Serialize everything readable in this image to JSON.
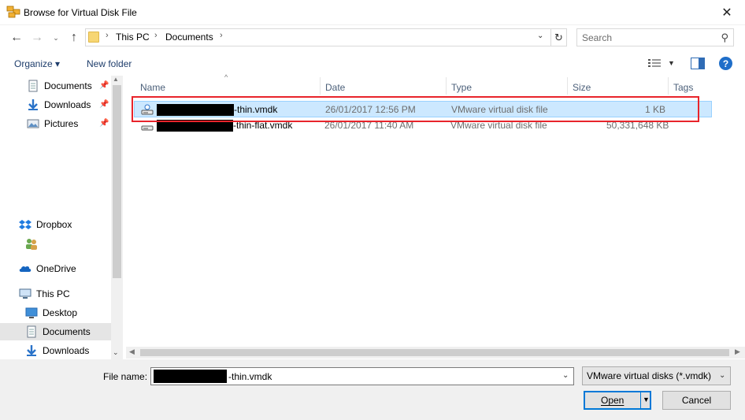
{
  "window": {
    "title": "Browse for Virtual Disk File",
    "close_glyph": "✕"
  },
  "address": {
    "crumbs": [
      "This PC",
      "Documents"
    ],
    "search_placeholder": "Search"
  },
  "toolbar": {
    "organize_label": "Organize ▾",
    "new_folder_label": "New folder",
    "help_label": "?"
  },
  "nav": {
    "items": [
      {
        "label": "Documents",
        "icon": "documents-icon",
        "pinned": true
      },
      {
        "label": "Downloads",
        "icon": "downloads-icon",
        "pinned": true
      },
      {
        "label": "Pictures",
        "icon": "pictures-icon",
        "pinned": true
      },
      {
        "label": "Dropbox",
        "icon": "dropbox-icon",
        "pinned": false
      },
      {
        "label": "",
        "icon": "shared-users-icon",
        "pinned": false
      },
      {
        "label": "OneDrive",
        "icon": "onedrive-icon",
        "pinned": false
      },
      {
        "label": "This PC",
        "icon": "computer-icon",
        "pinned": false
      },
      {
        "label": "Desktop",
        "icon": "desktop-icon",
        "pinned": false
      },
      {
        "label": "Documents",
        "icon": "documents-icon",
        "pinned": false,
        "selected": true
      },
      {
        "label": "Downloads",
        "icon": "downloads-icon",
        "pinned": false
      }
    ]
  },
  "columns": [
    "Name",
    "Date",
    "Type",
    "Size",
    "Tags"
  ],
  "files": [
    {
      "name_suffix": "-thin.vmdk",
      "date": "26/01/2017 12:56 PM",
      "type": "VMware virtual disk file",
      "size": "1 KB",
      "selected": true
    },
    {
      "name_suffix": "-thin-flat.vmdk",
      "date": "26/01/2017 11:40 AM",
      "type": "VMware virtual disk file",
      "size": "50,331,648 KB",
      "selected": false
    }
  ],
  "bottom": {
    "filename_label": "File name:",
    "filename_value": "-thin.vmdk",
    "filetype_value": "VMware virtual disks (*.vmdk)",
    "open_label": "Open",
    "cancel_label": "Cancel"
  },
  "colors": {
    "accent": "#0078d7",
    "highlight_outline": "#e8242b",
    "selection": "#cce8ff"
  }
}
